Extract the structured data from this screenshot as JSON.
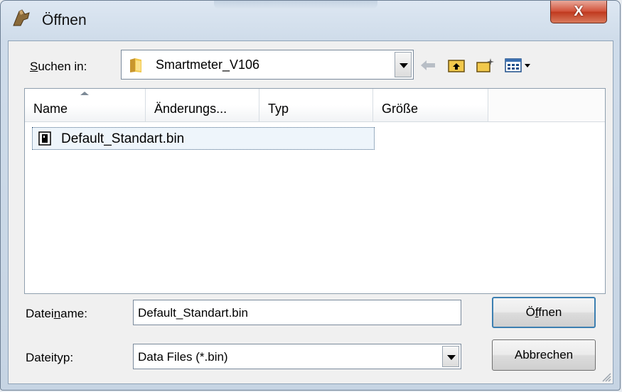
{
  "window": {
    "title": "Öffnen",
    "close_label": "X"
  },
  "lookin": {
    "label_pre": "",
    "label_u": "S",
    "label_post": "uchen in:",
    "value": "Smartmeter_V106"
  },
  "columns": [
    {
      "label": "Name"
    },
    {
      "label": "Änderungs..."
    },
    {
      "label": "Typ"
    },
    {
      "label": "Größe"
    }
  ],
  "files": [
    {
      "name": "Default_Standart.bin"
    }
  ],
  "filename": {
    "label_pre": "Datei",
    "label_u": "n",
    "label_post": "ame:",
    "value": "Default_Standart.bin"
  },
  "filetype": {
    "label": "Dateityp:",
    "value": "Data Files (*.bin)"
  },
  "buttons": {
    "open_pre": "Ö",
    "open_u": "f",
    "open_post": "fnen",
    "cancel": "Abbrechen"
  },
  "colors": {
    "accent": "#3c7fb1",
    "close": "#c0391f",
    "selection": "#eef5fb"
  }
}
